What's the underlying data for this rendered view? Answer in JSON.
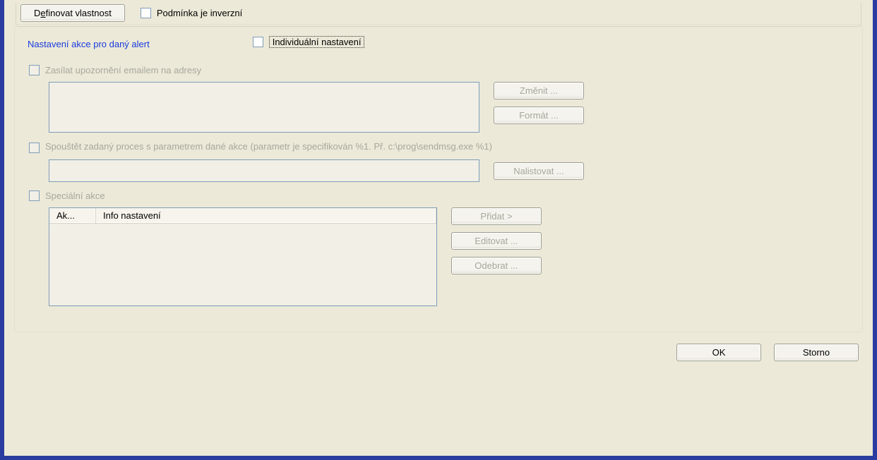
{
  "top": {
    "define_button_pre": "D",
    "define_button_u": "e",
    "define_button_post": "finovat vlastnost",
    "invert_label": "Podmínka je inverzní"
  },
  "group": {
    "title": "Nastavení akce pro daný alert",
    "individual_checkbox_label": "Individuální nastavení"
  },
  "email": {
    "checkbox_label": "Zasílat upozornění emailem na adresy",
    "btn_change": "Změnit ...",
    "btn_format": "Formát ..."
  },
  "process": {
    "checkbox_label": "Spouštět zadaný proces s parametrem dané akce (parametr je specifikován %1. Př. c:\\prog\\sendmsg.exe %1)",
    "btn_browse": "Nalistovat ..."
  },
  "special": {
    "checkbox_label": "Speciální akce",
    "col1": "Ak...",
    "col2": "Info nastavení",
    "btn_add": "Přidat >",
    "btn_edit": "Editovat ...",
    "btn_remove": "Odebrat ..."
  },
  "footer": {
    "ok": "OK",
    "cancel": "Storno"
  }
}
